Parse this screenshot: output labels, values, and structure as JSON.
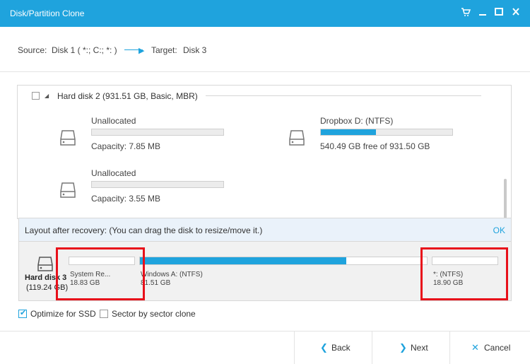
{
  "window": {
    "title": "Disk/Partition Clone",
    "controls": [
      "cart-icon",
      "minimize-icon",
      "maximize-icon",
      "close-icon"
    ]
  },
  "source_bar": {
    "source_label": "Source:",
    "source_value": "Disk 1 ( *:; C:; *: )",
    "target_label": "Target:",
    "target_value": "Disk 3"
  },
  "disk_list": {
    "disk_header": "Hard disk 2 (931.51 GB, Basic, MBR)",
    "partitions": [
      {
        "name": "Unallocated",
        "capacity": "Capacity: 7.85 MB",
        "used_fraction": 0
      },
      {
        "name": "Dropbox D: (NTFS)",
        "capacity": "540.49 GB free of 931.50 GB",
        "used_fraction": 0.42
      },
      {
        "name": "Unallocated",
        "capacity": "Capacity: 3.55 MB",
        "used_fraction": 0
      }
    ]
  },
  "layout": {
    "header": "Layout after recovery: (You can drag the disk to resize/move it.)",
    "ok_label": "OK",
    "disk_name": "Hard disk 3",
    "disk_size": "(119.24 GB)",
    "partitions": [
      {
        "name": "System Re...",
        "size": "18.83 GB",
        "used_fraction": 0
      },
      {
        "name": "Windows A: (NTFS)",
        "size": "81.51 GB",
        "used_fraction": 0.72
      },
      {
        "name": "*: (NTFS)",
        "size": "18.90 GB",
        "used_fraction": 0
      }
    ]
  },
  "options": {
    "optimize_ssd": {
      "label": "Optimize for SSD",
      "checked": true
    },
    "sector_clone": {
      "label": "Sector by sector clone",
      "checked": false
    }
  },
  "footer": {
    "back_label": "Back",
    "next_label": "Next",
    "cancel_label": "Cancel"
  },
  "colors": {
    "accent": "#1fa3dd",
    "highlight": "#e8101a"
  }
}
